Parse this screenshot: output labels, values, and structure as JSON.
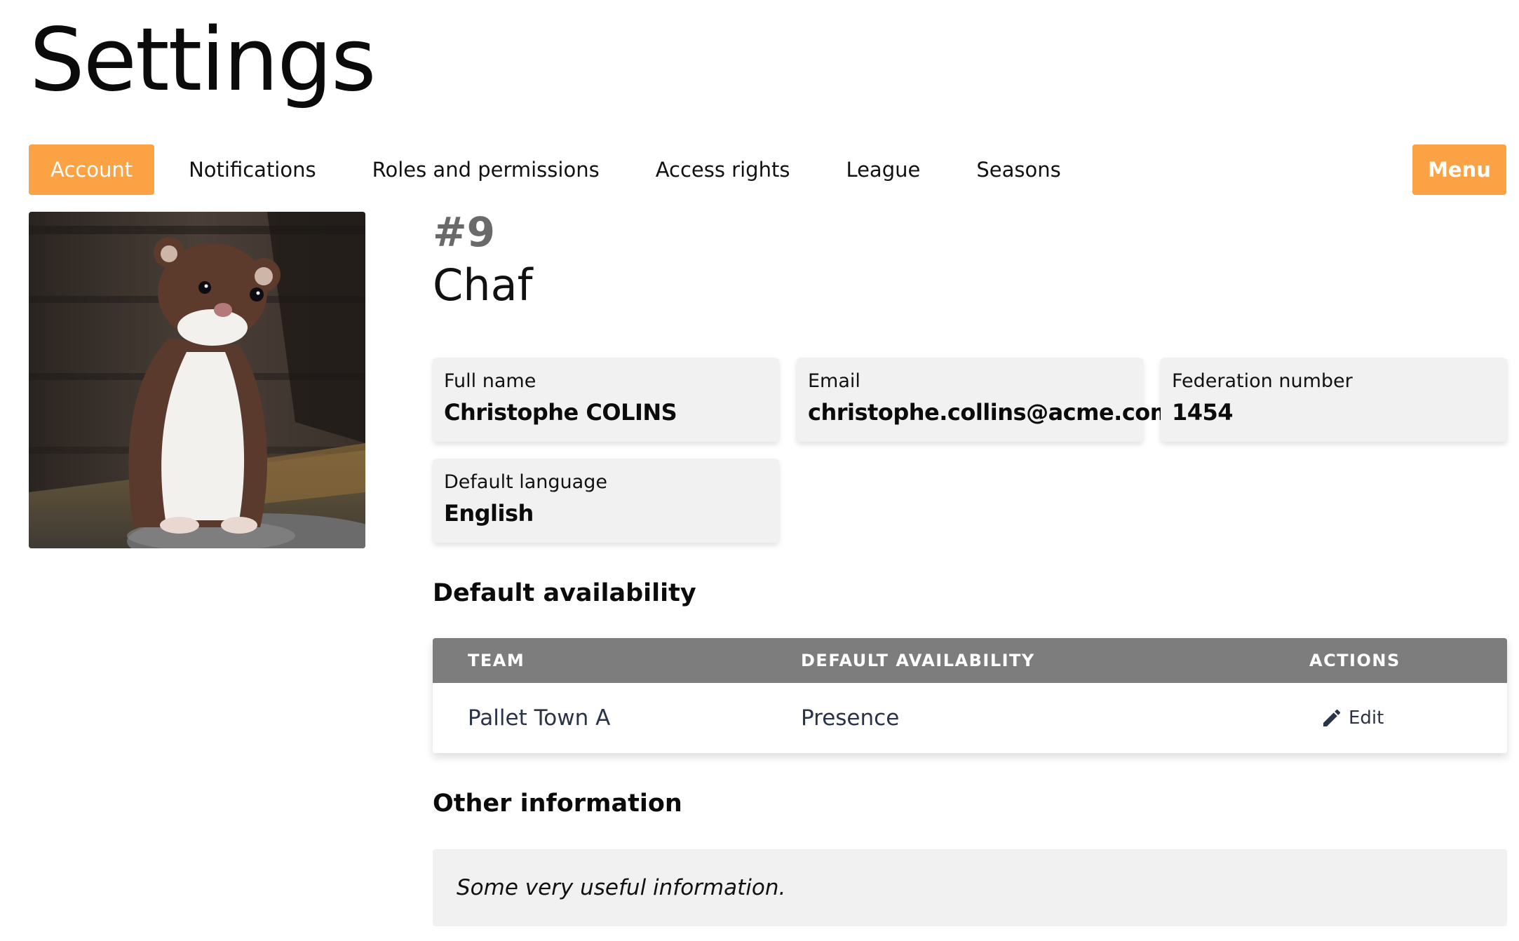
{
  "page": {
    "title": "Settings"
  },
  "tabs": [
    {
      "label": "Account",
      "active": true
    },
    {
      "label": "Notifications",
      "active": false
    },
    {
      "label": "Roles and permissions",
      "active": false
    },
    {
      "label": "Access rights",
      "active": false
    },
    {
      "label": "League",
      "active": false
    },
    {
      "label": "Seasons",
      "active": false
    }
  ],
  "menu_button": {
    "label": "Menu"
  },
  "profile": {
    "number": "#9",
    "nickname": "Chaf",
    "avatar_description": "photo of a stoat standing near a wooden fence"
  },
  "fields": {
    "full_name": {
      "label": "Full name",
      "value": "Christophe COLINS"
    },
    "email": {
      "label": "Email",
      "value": "christophe.collins@acme.com"
    },
    "federation_number": {
      "label": "Federation number",
      "value": "1454"
    },
    "default_language": {
      "label": "Default language",
      "value": "English"
    }
  },
  "availability": {
    "title": "Default availability",
    "columns": [
      "TEAM",
      "DEFAULT AVAILABILITY",
      "ACTIONS"
    ],
    "rows": [
      {
        "team": "Pallet Town A",
        "availability": "Presence",
        "action": "Edit"
      }
    ]
  },
  "other_info": {
    "title": "Other information",
    "text": "Some very useful information."
  },
  "colors": {
    "accent": "#fba344",
    "table_header": "#7d7d7d",
    "card_bg": "#f1f1f1"
  }
}
